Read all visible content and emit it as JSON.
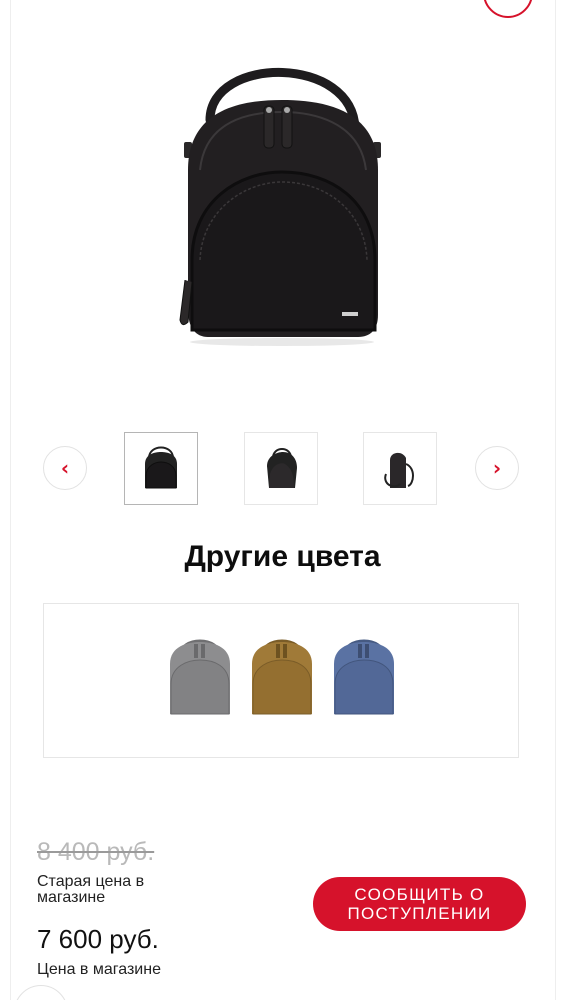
{
  "gallery": {
    "prev_icon": "chevron-left-icon",
    "next_icon": "chevron-right-icon",
    "prev_glyph": "‹",
    "next_glyph": "›",
    "active_thumbnail": 1
  },
  "other_colors": {
    "title": "Другие цвета",
    "swatches": [
      "gray",
      "gold",
      "blue"
    ]
  },
  "pricing": {
    "old_price": "8 400 руб.",
    "old_price_label": "Старая цена в магазине",
    "price": "7 600 руб.",
    "price_label": "Цена в магазине"
  },
  "actions": {
    "notify_label": "СООБЩИТЬ О ПОСТУПЛЕНИИ"
  },
  "colors": {
    "accent": "#d6122b",
    "product_main": "#1f1d1f",
    "swatch_gray": "#8d8d8f",
    "swatch_gold": "#a07a38",
    "swatch_blue": "#5a72a3"
  }
}
